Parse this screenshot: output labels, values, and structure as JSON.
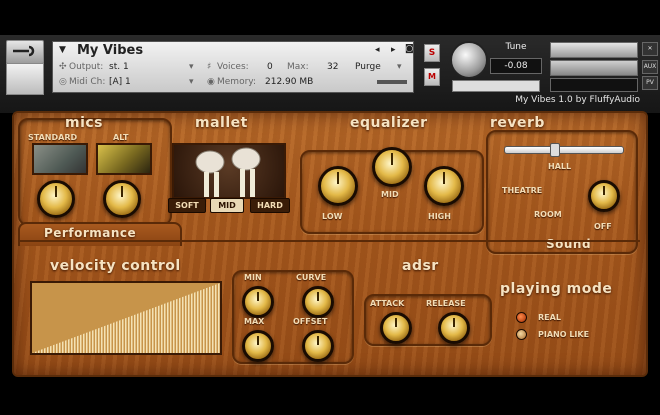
{
  "header": {
    "instrument_title": "My Vibes",
    "output_label": "Output:",
    "output_value": "st. 1",
    "voices_label": "Voices:",
    "voices_value": "0",
    "max_label": "Max:",
    "max_value": "32",
    "purge_label": "Purge",
    "midi_label": "Midi Ch:",
    "midi_value": "[A]  1",
    "memory_label": "Memory:",
    "memory_value": "212.90 MB",
    "s_button": "S",
    "m_button": "M",
    "tune_label": "Tune",
    "tune_value": "-0.08",
    "credit": "My Vibes 1.0 by FluffyAudio",
    "aux_label": "AUX",
    "pv_label": "PV"
  },
  "mics": {
    "title": "mics",
    "standard_label": "STANDARD",
    "alt_label": "ALT"
  },
  "mallet": {
    "title": "mallet",
    "buttons": [
      "SOFT",
      "MID",
      "HARD"
    ],
    "selected": "MID"
  },
  "equalizer": {
    "title": "equalizer",
    "low_label": "LOW",
    "mid_label": "MID",
    "high_label": "HIGH"
  },
  "reverb": {
    "title": "reverb",
    "hall_label": "HALL",
    "theatre_label": "THEATRE",
    "room_label": "ROOM",
    "off_label": "OFF"
  },
  "tabs": {
    "performance": "Performance",
    "sound": "Sound"
  },
  "velocity": {
    "title": "velocity control",
    "min_label": "MIN",
    "curve_label": "CURVE",
    "max_label": "MAX",
    "offset_label": "OFFSET"
  },
  "adsr": {
    "title": "adsr",
    "attack_label": "ATTACK",
    "release_label": "RELEASE"
  },
  "playing_mode": {
    "title": "playing mode",
    "options": [
      "REAL",
      "PIANO LIKE"
    ],
    "selected": "REAL"
  },
  "colors": {
    "wood": "#a85a1f",
    "label": "#f3ddb6",
    "knob_gold": "#e3b948"
  }
}
